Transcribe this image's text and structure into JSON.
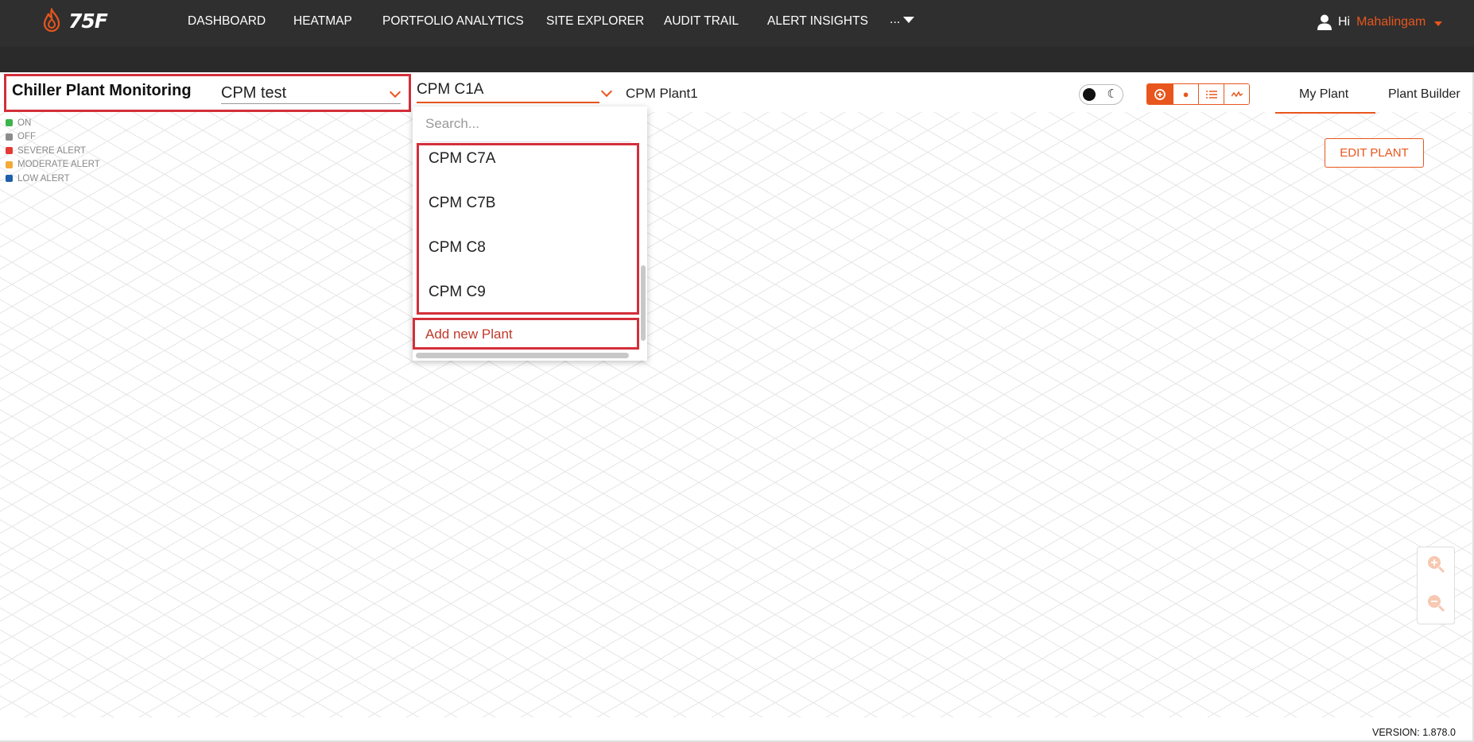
{
  "brand": {
    "logo_text": "75F"
  },
  "nav": {
    "items": [
      "DASHBOARD",
      "HEATMAP",
      "PORTFOLIO ANALYTICS",
      "SITE EXPLORER",
      "AUDIT TRAIL",
      "ALERT INSIGHTS"
    ],
    "more_label": "..."
  },
  "user": {
    "greeting": "Hi",
    "name": "Mahalingam"
  },
  "toolbar": {
    "page_title": "Chiller Plant Monitoring",
    "site_select_value": "CPM test",
    "plant_select_value": "CPM C1A",
    "plant_name": "CPM Plant1",
    "tabs": [
      "My Plant",
      "Plant Builder"
    ],
    "active_tab": "My Plant"
  },
  "legend": [
    {
      "label": "ON",
      "color": "#3cb44b"
    },
    {
      "label": "OFF",
      "color": "#8c8c8c"
    },
    {
      "label": "SEVERE ALERT",
      "color": "#e53935"
    },
    {
      "label": "MODERATE ALERT",
      "color": "#f4a938"
    },
    {
      "label": "LOW ALERT",
      "color": "#1e5fa8"
    }
  ],
  "edit_plant_label": "EDIT PLANT",
  "dropdown": {
    "search_placeholder": "Search...",
    "options": [
      "CPM C7A",
      "CPM C7B",
      "CPM C8",
      "CPM C9"
    ],
    "add_label": "Add new Plant"
  },
  "version": "VERSION: 1.878.0",
  "colors": {
    "accent": "#e8561d",
    "highlight": "#d32f3a",
    "topbar": "#2f2f2f"
  }
}
